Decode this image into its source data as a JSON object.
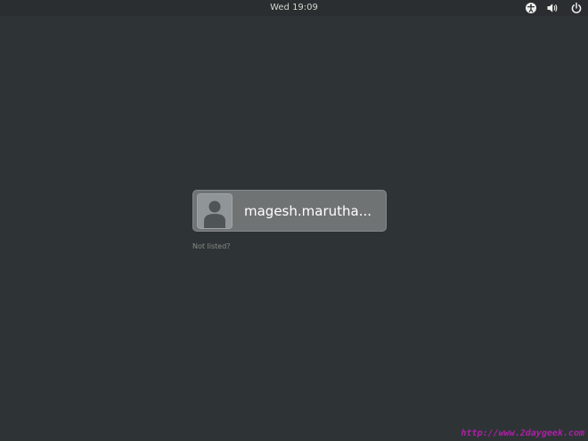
{
  "topbar": {
    "clock": "Wed 19:09",
    "icons": [
      "accessibility-icon",
      "volume-icon",
      "power-icon"
    ]
  },
  "login": {
    "username": "magesh.marutha...",
    "avatar_icon": "user-avatar-icon",
    "not_listed": "Not listed?"
  },
  "watermark": "http://www.2daygeek.com",
  "colors": {
    "background": "#2e3436",
    "topbar": "#2a2e30",
    "user_button": "#6f7374",
    "watermark": "#b01fa8"
  }
}
